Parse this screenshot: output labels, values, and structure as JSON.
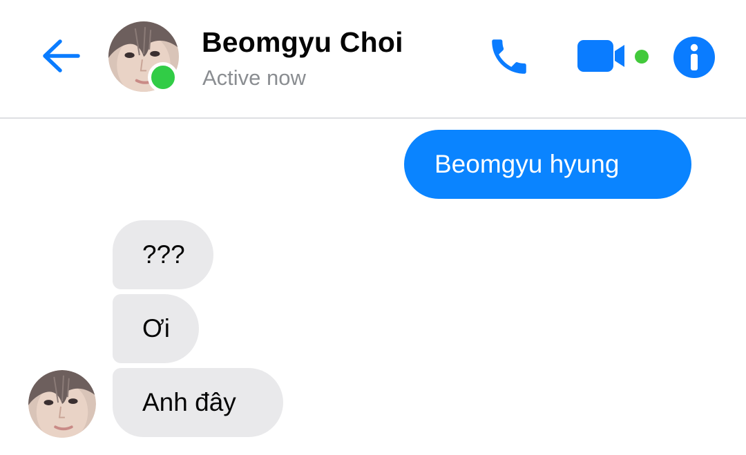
{
  "header": {
    "contact_name": "Beomgyu Choi",
    "status": "Active now",
    "icons": {
      "back": "arrow-left-icon",
      "call": "phone-icon",
      "video": "video-camera-icon",
      "info": "info-icon"
    }
  },
  "colors": {
    "accent": "#0a84ff",
    "presence": "#31cc46",
    "incoming_bubble": "#e9e9eb",
    "status_text": "#8a8d91"
  },
  "messages": [
    {
      "direction": "outgoing",
      "text": "Beomgyu hyung"
    },
    {
      "direction": "incoming",
      "text": "???"
    },
    {
      "direction": "incoming",
      "text": "Ơi"
    },
    {
      "direction": "incoming",
      "text": "Anh đây"
    }
  ]
}
